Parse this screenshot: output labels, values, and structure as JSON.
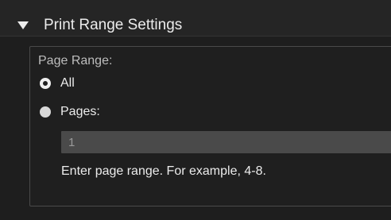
{
  "section": {
    "title": "Print Range Settings",
    "expanded_icon": "triangle-down-icon"
  },
  "page_range": {
    "label": "Page Range:",
    "options": [
      {
        "label": "All",
        "selected": true
      },
      {
        "label": "Pages:",
        "selected": false
      }
    ],
    "pages_input": {
      "value": "1"
    },
    "hint": "Enter page range. For example, 4-8."
  },
  "colors": {
    "panel_background": "#1e1e1e",
    "input_background": "#4a4a4a",
    "text": "#ececec"
  }
}
